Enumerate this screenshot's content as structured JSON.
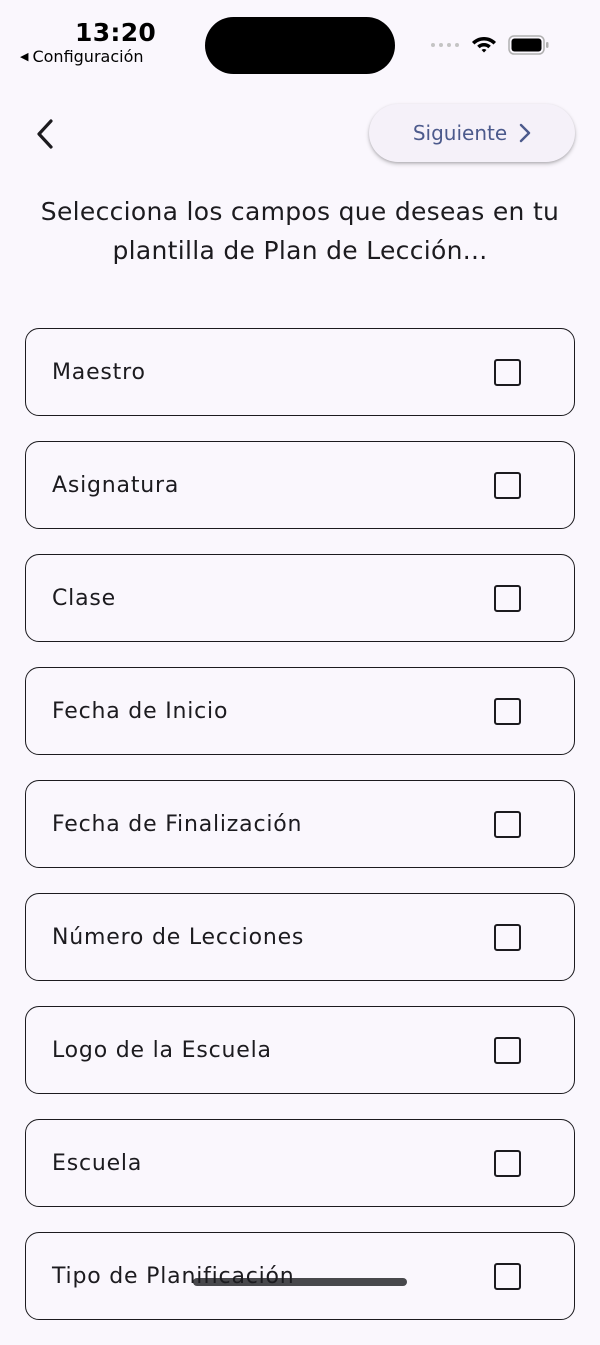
{
  "status_bar": {
    "time": "13:20",
    "back_app": "Configuración",
    "back_arrow": "◀"
  },
  "nav": {
    "back_icon": "chevron-left-icon",
    "next_label": "Siguiente",
    "next_icon": "chevron-right-icon"
  },
  "instruction": "Selecciona los campos que deseas en tu plantilla de Plan de Lección...",
  "fields": [
    {
      "label": "Maestro",
      "checked": false
    },
    {
      "label": "Asignatura",
      "checked": false
    },
    {
      "label": "Clase",
      "checked": false
    },
    {
      "label": "Fecha de Inicio",
      "checked": false
    },
    {
      "label": "Fecha de Finalización",
      "checked": false
    },
    {
      "label": "Número de Lecciones",
      "checked": false
    },
    {
      "label": "Logo de la Escuela",
      "checked": false
    },
    {
      "label": "Escuela",
      "checked": false
    },
    {
      "label": "Tipo de Planificación",
      "checked": false
    }
  ],
  "colors": {
    "background": "#FAF7FD",
    "accent": "#4C5A8C",
    "text": "#1C1B1F"
  }
}
